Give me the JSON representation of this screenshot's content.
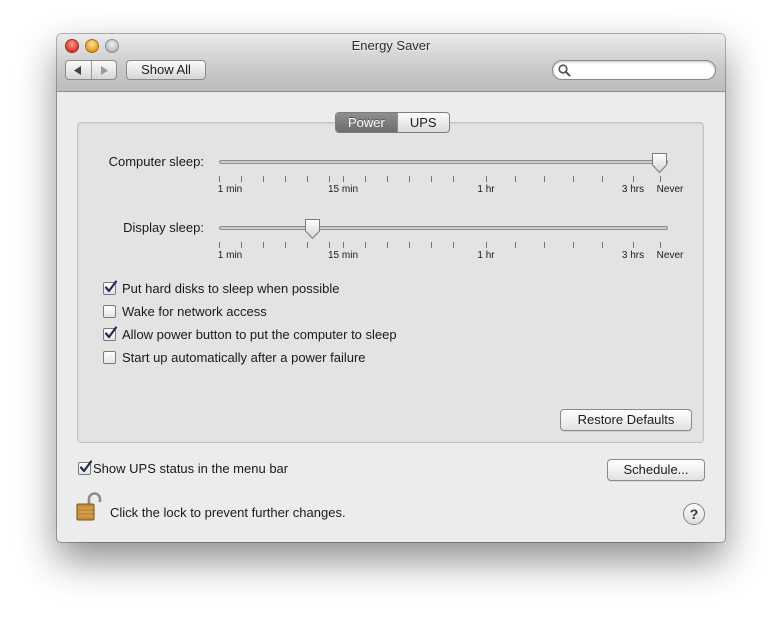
{
  "window": {
    "title": "Energy Saver"
  },
  "toolbar": {
    "back_icon": "back-arrow-icon",
    "forward_icon": "forward-arrow-icon",
    "show_all_label": "Show All",
    "search_placeholder": "",
    "search_value": ""
  },
  "tabs": [
    {
      "label": "Power",
      "selected": true
    },
    {
      "label": "UPS",
      "selected": false
    }
  ],
  "sliders": {
    "computer_sleep": {
      "label": "Computer sleep:",
      "value": "Never",
      "tick_labels": [
        "1 min",
        "15 min",
        "1 hr",
        "3 hrs",
        "Never"
      ]
    },
    "display_sleep": {
      "label": "Display sleep:",
      "value": "10 min",
      "tick_labels": [
        "1 min",
        "15 min",
        "1 hr",
        "3 hrs",
        "Never"
      ]
    }
  },
  "options": [
    {
      "label": "Put hard disks to sleep when possible",
      "checked": true
    },
    {
      "label": "Wake for network access",
      "checked": false
    },
    {
      "label": "Allow power button to put the computer to sleep",
      "checked": true
    },
    {
      "label": "Start up automatically after a power failure",
      "checked": false
    }
  ],
  "restore_defaults_label": "Restore Defaults",
  "ups_status": {
    "label": "Show UPS status in the menu bar",
    "checked": true
  },
  "schedule_label": "Schedule...",
  "lock": {
    "icon": "unlocked-padlock-icon",
    "text": "Click the lock to prevent further changes."
  },
  "help_label": "?"
}
